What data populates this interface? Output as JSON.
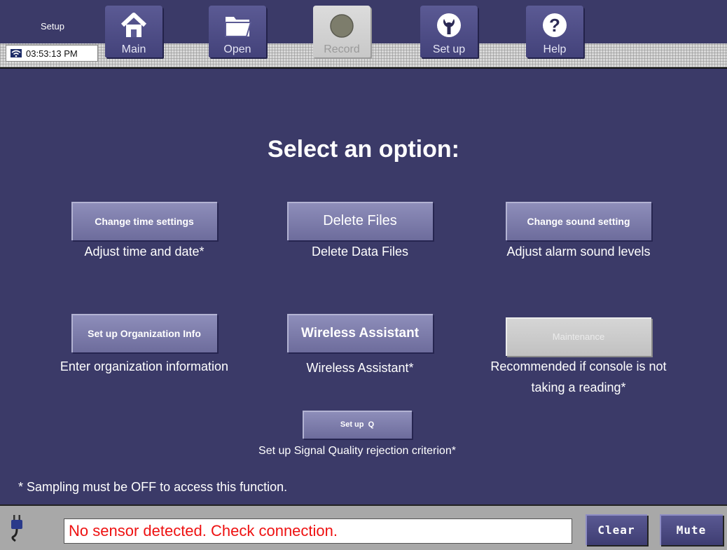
{
  "header": {
    "screen_title": "Setup",
    "time": "03:53:13 PM",
    "tabs": [
      {
        "label": "Main",
        "icon": "home-icon",
        "enabled": true
      },
      {
        "label": "Open",
        "icon": "folder-icon",
        "enabled": true
      },
      {
        "label": "Record",
        "icon": "record-icon",
        "enabled": false
      },
      {
        "label": "Set up",
        "icon": "wrench-icon",
        "enabled": true
      },
      {
        "label": "Help",
        "icon": "help-icon",
        "enabled": true
      }
    ]
  },
  "main": {
    "heading": "Select an option:",
    "options": [
      {
        "button": "Change time settings",
        "description": "Adjust time and date*",
        "enabled": true
      },
      {
        "button": "Delete Files",
        "description": "Delete Data Files",
        "enabled": true
      },
      {
        "button": "Change sound setting",
        "description": "Adjust alarm sound levels",
        "enabled": true
      },
      {
        "button": "Set up Organization Info",
        "description": "Enter organization information",
        "enabled": true
      },
      {
        "button": "Wireless Assistant",
        "description": "Wireless Assistant*",
        "enabled": true
      },
      {
        "button": "Maintenance",
        "description_line1": "Recommended if console is not",
        "description_line2": "taking a reading*",
        "enabled": false
      },
      {
        "button": "Set up  Q",
        "description": "Set up Signal Quality rejection criterion*",
        "enabled": true
      }
    ],
    "note": "* Sampling must be OFF to access this function."
  },
  "status": {
    "message": "No sensor detected. Check connection.",
    "message_color": "#ee1111",
    "clear_label": "Clear",
    "mute_label": "Mute"
  }
}
